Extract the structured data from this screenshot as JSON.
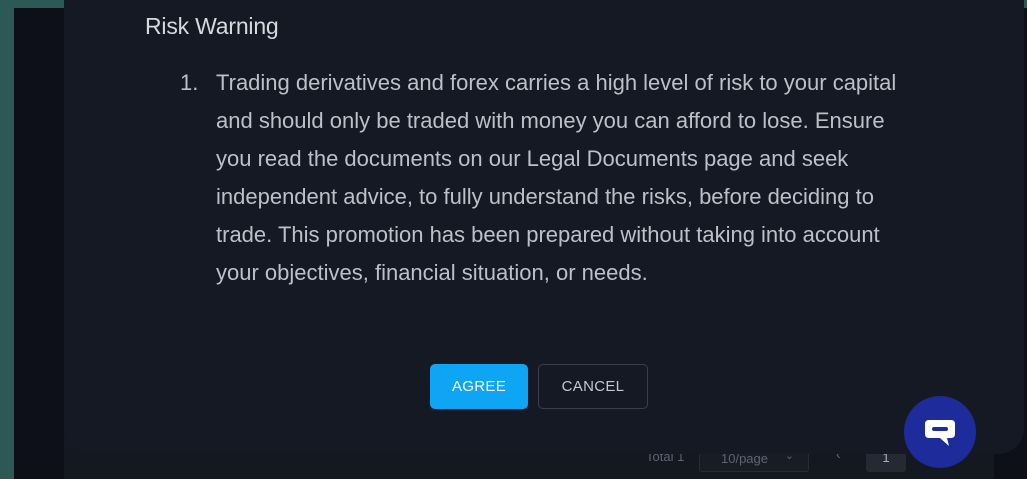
{
  "dialog": {
    "title": "Risk Warning",
    "items": [
      {
        "number": "1.",
        "text": "Trading derivatives and forex carries a high level of risk to your capital and should only be traded with money you can afford to lose. Ensure you read the documents on our Legal Documents page and seek independent advice, to fully understand the risks, before deciding to trade. This promotion has been prepared without taking into account your objectives, financial situation, or needs."
      }
    ],
    "agree_label": "AGREE",
    "cancel_label": "CANCEL"
  },
  "pagination": {
    "total_label": "Total 1",
    "page_size": "10/page",
    "prev_icon": "chevron-left-icon",
    "current_page": "1"
  },
  "chat": {
    "icon": "chat-bubble-icon"
  },
  "colors": {
    "accent": "#0ea5f5",
    "dialog_bg": "#141923",
    "chat_fab": "#1e2b9a"
  }
}
